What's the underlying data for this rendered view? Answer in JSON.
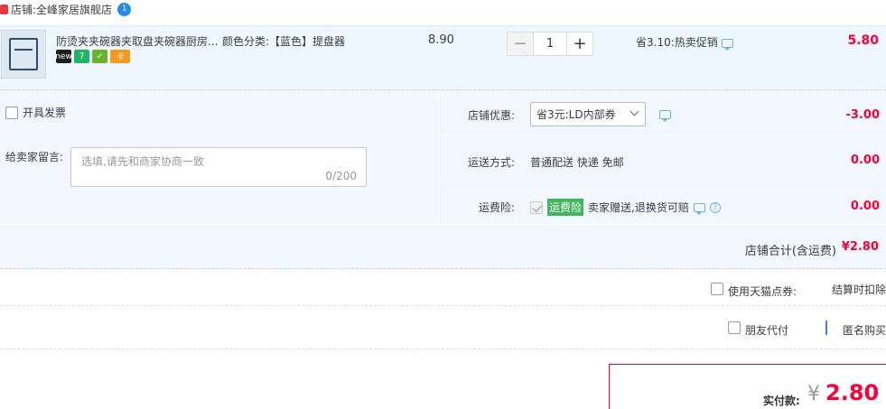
{
  "shop": {
    "label": "店铺:",
    "name": "全峰家居旗舰店",
    "badge": "1"
  },
  "item": {
    "title": "防烫夹夹碗器夹取盘夹碗器厨房...",
    "sku": "颜色分类:【蓝色】提盘器",
    "service_icons": [
      "new-icon",
      "seven-day-return-icon",
      "guarantee-icon",
      "card-icon"
    ],
    "service_text": [
      "new",
      "7",
      "✓",
      "卡"
    ],
    "unit_price": "8.90",
    "qty_minus": "−",
    "quantity": "1",
    "qty_plus": "+",
    "promo": "省3.10:热卖促销",
    "subtotal": "5.80"
  },
  "invoice_label": "开具发票",
  "memo": {
    "label": "给卖家留言:",
    "placeholder": "选填,请先和商家协商一致",
    "counter": "0/200"
  },
  "shop_coupon": {
    "label": "店铺优惠:",
    "selected": "省3元:LD内部券",
    "amount": "-3.00"
  },
  "shipping": {
    "label": "运送方式:",
    "method": "普通配送 快递 免邮",
    "amount": "0.00"
  },
  "insurance": {
    "label": "运费险:",
    "badge": "运费险",
    "text": "卖家赠送,退换货可赔",
    "amount": "0.00"
  },
  "shop_total": {
    "label": "店铺合计(含运费)",
    "amount": "¥2.80"
  },
  "points": {
    "label": "使用天猫点券:",
    "right_text": "结算时扣除"
  },
  "payment": {
    "friend_label": "朋友代付",
    "anonymous_label": "匿名购买",
    "anonymous_checked": true
  },
  "final": {
    "label": "实付款:",
    "currency": "¥",
    "amount": "2.80"
  },
  "colors": {
    "price_red": "#ff0036",
    "accent_blue": "#3d7cf4",
    "panel_bg": "#f2f7ff",
    "item_bg": "#eef6ff"
  }
}
